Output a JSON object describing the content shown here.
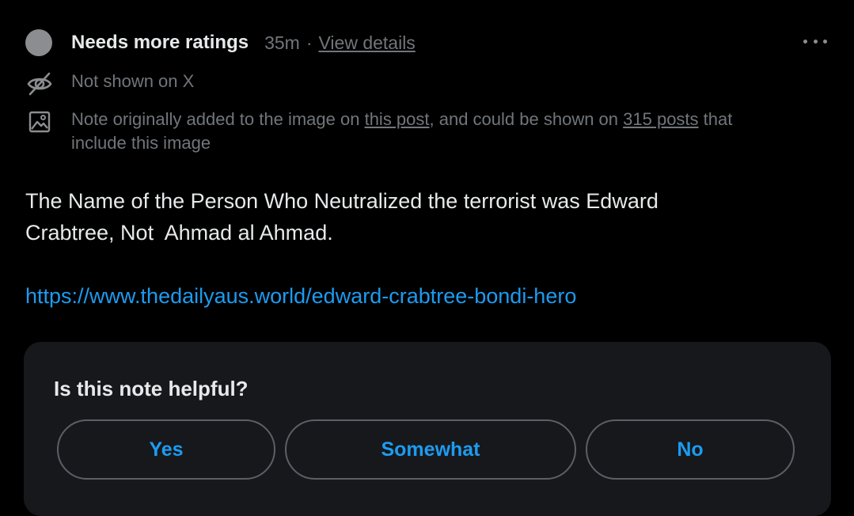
{
  "header": {
    "status": "Needs more ratings",
    "time": "35m",
    "separator": "·",
    "details_link": "View details"
  },
  "info": {
    "not_shown": "Not shown on X",
    "note_prefix": "Note originally added to the image on ",
    "this_post_link": "this post",
    "note_middle": ", and could be shown on ",
    "posts_count_link": "315 posts",
    "note_suffix": " that include this image"
  },
  "note": {
    "text": "The Name of the Person Who Neutralized the terrorist was Edward\nCrabtree, Not  Ahmad al Ahmad.",
    "link": "https://www.thedailyaus.world/edward-crabtree-bondi-hero"
  },
  "rating": {
    "question": "Is this note helpful?",
    "yes_label": "Yes",
    "somewhat_label": "Somewhat",
    "no_label": "No"
  },
  "colors": {
    "background": "#000000",
    "accent": "#1d9bf0",
    "muted_text": "#71767b",
    "card": "#16181c"
  },
  "icons": {
    "status": "status-dot-icon",
    "hidden": "eye-slash-icon",
    "image": "image-icon",
    "more": "more-horizontal-icon"
  }
}
